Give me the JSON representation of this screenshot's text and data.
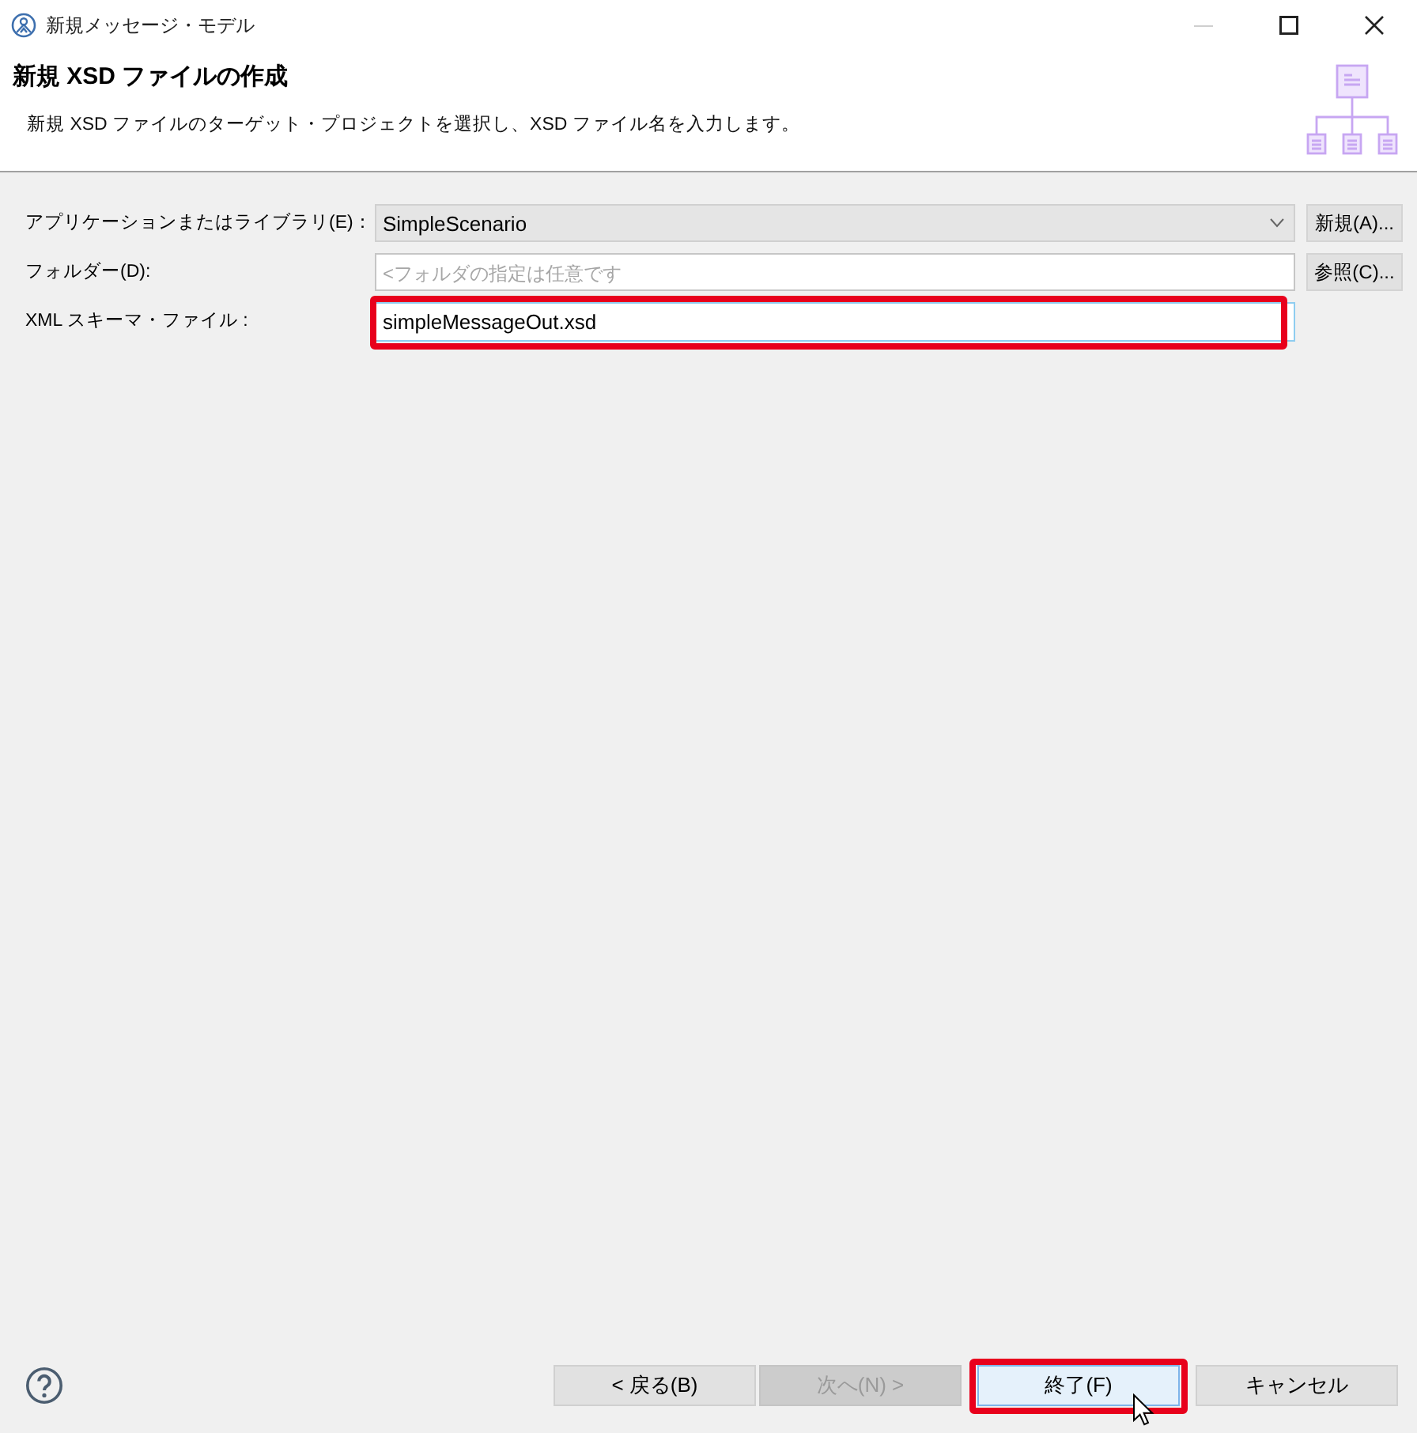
{
  "window": {
    "title": "新規メッセージ・モデル"
  },
  "header": {
    "title": "新規 XSD ファイルの作成",
    "description": "新規 XSD ファイルのターゲット・プロジェクトを選択し、XSD ファイル名を入力します。"
  },
  "form": {
    "rows": [
      {
        "kind": "combo",
        "label": "アプリケーションまたはライブラリ(E)：",
        "value": "SimpleScenario",
        "button": "新規(A)..."
      },
      {
        "kind": "text",
        "label": "フォルダー(D):",
        "placeholder": "<フォルダの指定は任意です",
        "button": "参照(C)...",
        "focused": false
      },
      {
        "kind": "text",
        "label": "XML スキーマ・ファイル :",
        "value": "simpleMessageOut.xsd",
        "focused": true,
        "highlighted": true
      }
    ]
  },
  "footer": {
    "buttons": [
      {
        "label": "< 戻る(B)",
        "disabled": false,
        "default": false
      },
      {
        "label": "次へ(N) >",
        "disabled": true,
        "default": false
      },
      {
        "label": "終了(F)",
        "disabled": false,
        "default": true,
        "highlighted": true
      },
      {
        "label": "キャンセル",
        "disabled": false,
        "default": false
      }
    ]
  }
}
